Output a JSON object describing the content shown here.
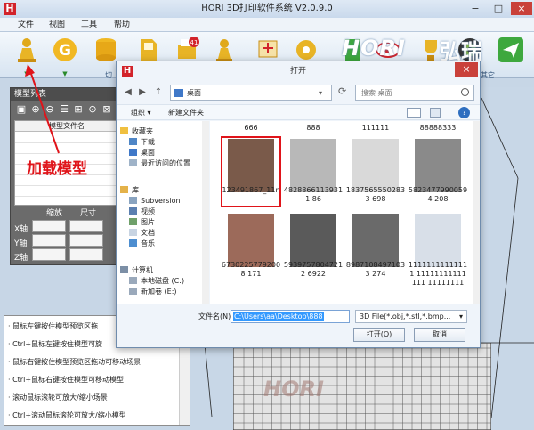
{
  "window": {
    "title": "HORI 3D打印软件系统 V2.0.9.0",
    "controls": [
      "−",
      "□",
      "×"
    ]
  },
  "menu": [
    "文件",
    "视图",
    "工具",
    "帮助"
  ],
  "toolbar": {
    "group_label_1": "切",
    "group_label_2": "其它",
    "brand_latin": "HORI",
    "brand_cn": "弘瑞",
    "icons": [
      "load-model",
      "g-code",
      "database",
      "sd-card",
      "print-queue",
      "pawn",
      "cut-tool",
      "gear",
      "green-marker",
      "settings-eye",
      "camera",
      "send"
    ],
    "badge": "41"
  },
  "model_panel": {
    "title": "模型列表",
    "column_header": "模型文件名",
    "scale_label": "缩放",
    "size_label": "尺寸",
    "axes": [
      "X轴",
      "Y轴",
      "Z轴"
    ]
  },
  "annotation": "加载模型",
  "tips": [
    "· 鼠标左键按住模型预览区拖",
    "· Ctrl+鼠标左键按住模型可旋",
    "· 鼠标右键按住模型预览区拖动可移动场景",
    "· Ctrl+鼠标右键按住模型可移动模型",
    "· 滚动鼠标滚轮可放大/缩小场景",
    "· Ctrl+滚动鼠标滚轮可放大/缩小模型"
  ],
  "watermark": "HORI",
  "dialog": {
    "title": "打开",
    "address": "桌面",
    "search_placeholder": "搜索 桌面",
    "organize": "组织 ▾",
    "new_folder": "新建文件夹",
    "nav": {
      "favorites": "收藏夹",
      "favorites_items": [
        "下载",
        "桌面",
        "最近访问的位置"
      ],
      "library": "库",
      "library_items": [
        "Subversion",
        "视频",
        "图片",
        "文档",
        "音乐"
      ],
      "computer": "计算机",
      "computer_items": [
        "本地磁盘 (C:)",
        "新加卷 (E:)"
      ]
    },
    "top_row_names": [
      "666",
      "888",
      "111111",
      "88888333"
    ],
    "files": [
      {
        "name": "123491867_11n",
        "selected": true,
        "tone": "#7a5a4a"
      },
      {
        "name": "48288661139311 86",
        "tone": "#b8b8b8"
      },
      {
        "name": "18375655502833 698",
        "tone": "#d9d9d9"
      },
      {
        "name": "58234779900594 208",
        "tone": "#8a8a8a"
      },
      {
        "name": "67302257792008 171",
        "tone": "#9c6a5a"
      },
      {
        "name": "59397578047212 6922",
        "tone": "#5a5a5a"
      },
      {
        "name": "89871084971033 274",
        "tone": "#6a6a6a"
      },
      {
        "name": "11111111111111 11111111111111 11111111",
        "tone": "#d8dfe8"
      }
    ],
    "filename_label": "文件名(N):",
    "filename_value": "C:\\Users\\aa\\Desktop\\888",
    "filter_value": "3D File(*.obj,*.stl,*.bmp...",
    "open_button": "打开(O)",
    "cancel_button": "取消"
  }
}
